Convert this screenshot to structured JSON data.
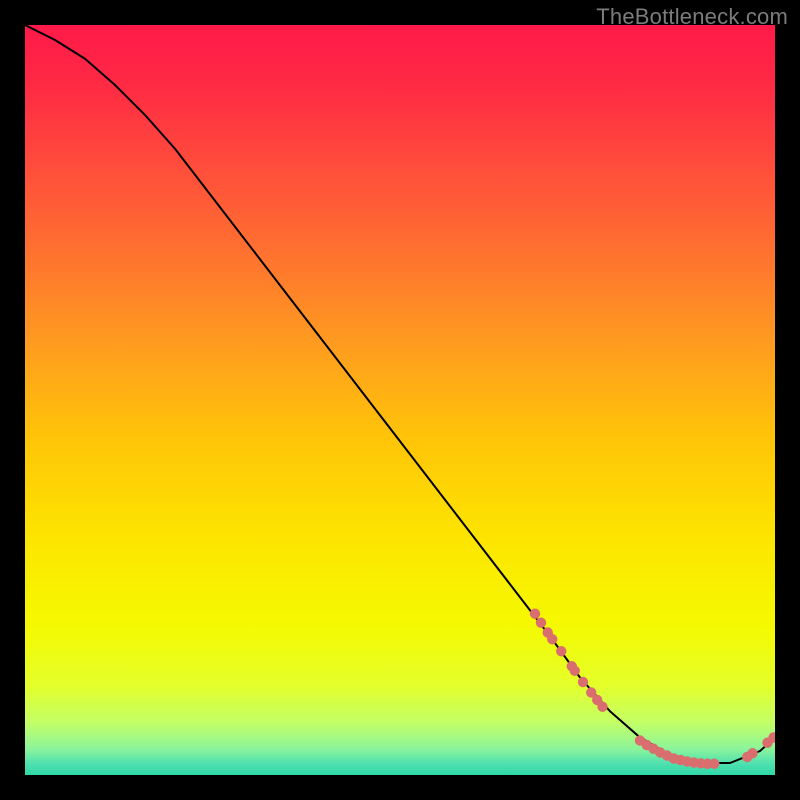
{
  "watermark": "TheBottleneck.com",
  "chart_data": {
    "type": "line",
    "title": "",
    "xlabel": "",
    "ylabel": "",
    "xlim": [
      0,
      100
    ],
    "ylim": [
      0,
      100
    ],
    "grid": false,
    "legend": false,
    "curve": {
      "x": [
        0,
        4,
        8,
        12,
        16,
        20,
        25,
        30,
        35,
        40,
        45,
        50,
        55,
        60,
        65,
        70,
        74,
        78,
        82,
        86,
        90,
        94,
        98,
        100
      ],
      "y": [
        100,
        98,
        95.5,
        92,
        88,
        83.5,
        77,
        70.5,
        64,
        57.5,
        51,
        44.5,
        38,
        31.5,
        25,
        18.5,
        13,
        8.5,
        5,
        2.7,
        1.6,
        1.6,
        3.2,
        5
      ]
    },
    "clusters": [
      {
        "name": "cluster-a",
        "color": "#da6d6d",
        "points": [
          {
            "x": 68.0,
            "y": 21.5
          },
          {
            "x": 68.8,
            "y": 20.3
          },
          {
            "x": 69.7,
            "y": 19.0
          },
          {
            "x": 70.3,
            "y": 18.1
          },
          {
            "x": 71.5,
            "y": 16.5
          },
          {
            "x": 72.9,
            "y": 14.5
          },
          {
            "x": 73.3,
            "y": 13.9
          },
          {
            "x": 74.4,
            "y": 12.4
          },
          {
            "x": 75.5,
            "y": 11.0
          },
          {
            "x": 76.3,
            "y": 10.0
          },
          {
            "x": 77.0,
            "y": 9.1
          }
        ]
      },
      {
        "name": "cluster-b",
        "color": "#da6d6d",
        "points": [
          {
            "x": 82.0,
            "y": 4.6
          },
          {
            "x": 82.9,
            "y": 4.0
          },
          {
            "x": 83.8,
            "y": 3.5
          },
          {
            "x": 84.7,
            "y": 3.0
          },
          {
            "x": 85.6,
            "y": 2.6
          },
          {
            "x": 86.5,
            "y": 2.2
          },
          {
            "x": 87.4,
            "y": 2.0
          },
          {
            "x": 88.3,
            "y": 1.8
          },
          {
            "x": 89.2,
            "y": 1.65
          },
          {
            "x": 90.1,
            "y": 1.55
          },
          {
            "x": 91.0,
            "y": 1.5
          },
          {
            "x": 91.9,
            "y": 1.5
          }
        ]
      },
      {
        "name": "cluster-c",
        "color": "#da6d6d",
        "points": [
          {
            "x": 96.3,
            "y": 2.4
          },
          {
            "x": 97.0,
            "y": 2.9
          },
          {
            "x": 99.0,
            "y": 4.3
          },
          {
            "x": 99.8,
            "y": 5.0
          }
        ]
      }
    ],
    "background_gradient": {
      "stops": [
        {
          "offset": 0.0,
          "color": "#ff1a49"
        },
        {
          "offset": 0.08,
          "color": "#ff2a44"
        },
        {
          "offset": 0.18,
          "color": "#ff4a3c"
        },
        {
          "offset": 0.3,
          "color": "#ff7030"
        },
        {
          "offset": 0.42,
          "color": "#ff9a20"
        },
        {
          "offset": 0.55,
          "color": "#ffc408"
        },
        {
          "offset": 0.68,
          "color": "#fde400"
        },
        {
          "offset": 0.8,
          "color": "#f5f900"
        },
        {
          "offset": 0.88,
          "color": "#e4ff2a"
        },
        {
          "offset": 0.93,
          "color": "#c3ff66"
        },
        {
          "offset": 0.965,
          "color": "#8cf49b"
        },
        {
          "offset": 0.985,
          "color": "#4fe0af"
        },
        {
          "offset": 1.0,
          "color": "#2fd7a8"
        }
      ]
    }
  }
}
